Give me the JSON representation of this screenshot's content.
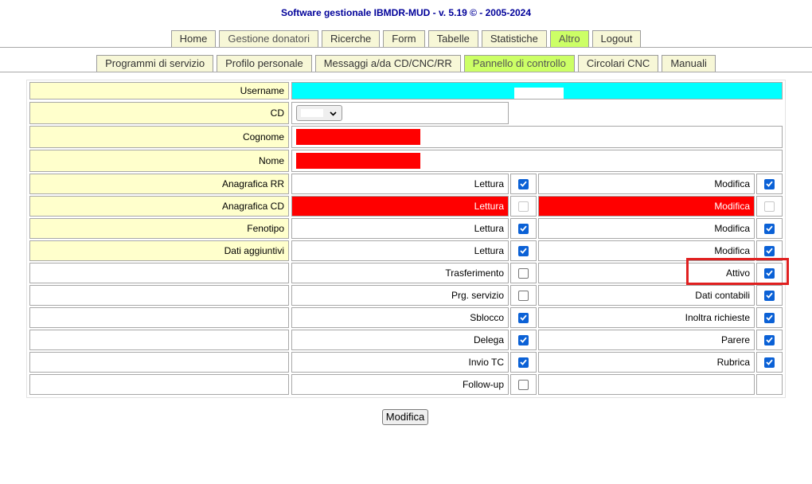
{
  "app": {
    "title": "Software gestionale IBMDR-MUD - v. 5.19 © - 2005-2024"
  },
  "nav": {
    "main_tabs": [
      {
        "label": "Home",
        "state": "normal"
      },
      {
        "label": "Gestione donatori",
        "state": "gray"
      },
      {
        "label": "Ricerche",
        "state": "normal"
      },
      {
        "label": "Form",
        "state": "normal"
      },
      {
        "label": "Tabelle",
        "state": "normal"
      },
      {
        "label": "Statistiche",
        "state": "normal"
      },
      {
        "label": "Altro",
        "state": "active"
      },
      {
        "label": "Logout",
        "state": "normal"
      }
    ],
    "sub_tabs": [
      {
        "label": "Programmi di servizio",
        "state": "normal"
      },
      {
        "label": "Profilo personale",
        "state": "normal"
      },
      {
        "label": "Messaggi a/da CD/CNC/RR",
        "state": "normal"
      },
      {
        "label": "Pannello di controllo",
        "state": "active"
      },
      {
        "label": "Circolari CNC",
        "state": "normal"
      },
      {
        "label": "Manuali",
        "state": "normal"
      }
    ]
  },
  "form": {
    "username_label": "Username",
    "cd_label": "CD",
    "cognome_label": "Cognome",
    "nome_label": "Nome",
    "permissions": [
      {
        "section": "Anagrafica RR",
        "left": {
          "label": "Lettura",
          "checked": true
        },
        "right": {
          "label": "Modifica",
          "checked": true
        }
      },
      {
        "section": "Anagrafica CD",
        "highlight": "red",
        "left": {
          "label": "Lettura",
          "checked": false,
          "disabled": true
        },
        "right": {
          "label": "Modifica",
          "checked": false,
          "disabled": true
        }
      },
      {
        "section": "Fenotipo",
        "left": {
          "label": "Lettura",
          "checked": true
        },
        "right": {
          "label": "Modifica",
          "checked": true
        }
      },
      {
        "section": "Dati aggiuntivi",
        "left": {
          "label": "Lettura",
          "checked": true
        },
        "right": {
          "label": "Modifica",
          "checked": true
        }
      },
      {
        "section": "",
        "left": {
          "label": "Trasferimento",
          "checked": false
        },
        "right": {
          "label": "Attivo",
          "checked": true
        }
      },
      {
        "section": "",
        "left": {
          "label": "Prg. servizio",
          "checked": false
        },
        "right": {
          "label": "Dati contabili",
          "checked": true
        }
      },
      {
        "section": "",
        "left": {
          "label": "Sblocco",
          "checked": true
        },
        "right": {
          "label": "Inoltra richieste",
          "checked": true
        }
      },
      {
        "section": "",
        "left": {
          "label": "Delega",
          "checked": true
        },
        "right": {
          "label": "Parere",
          "checked": true
        }
      },
      {
        "section": "",
        "left": {
          "label": "Invio TC",
          "checked": true
        },
        "right": {
          "label": "Rubrica",
          "checked": true
        }
      },
      {
        "section": "",
        "left": {
          "label": "Follow-up",
          "checked": false
        },
        "right": null
      }
    ],
    "submit_label": "Modifica"
  },
  "colors": {
    "title": "#000099",
    "label_bg": "#ffffcc",
    "username_bg": "#00ffff",
    "warning_red": "#ff0000",
    "active_tab": "#ccff66",
    "checkbox_blue": "#0b61d6",
    "annotation_box": "#e02020"
  }
}
